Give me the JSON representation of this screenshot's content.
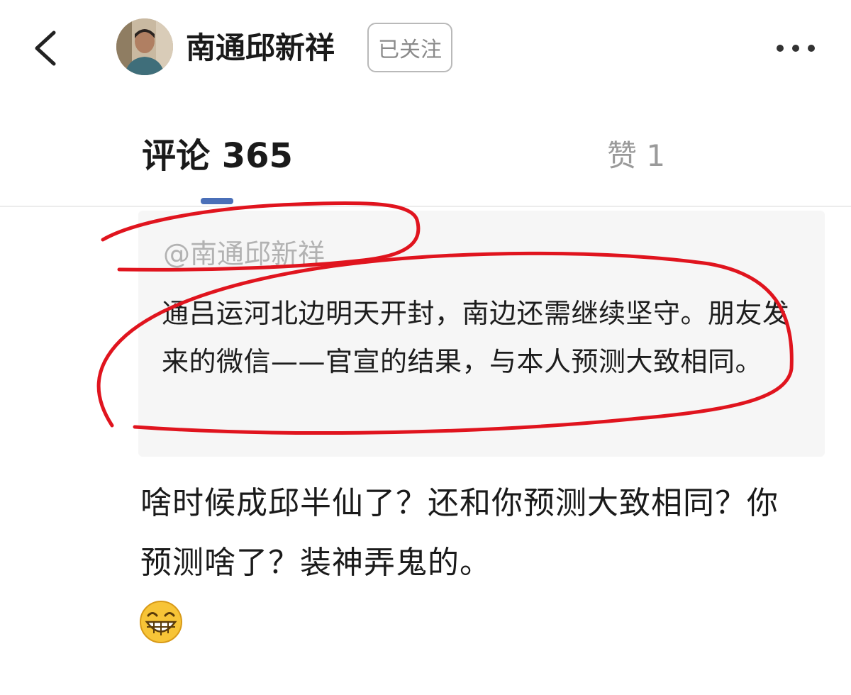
{
  "header": {
    "author_name": "南通邱新祥",
    "follow_label": "已关注",
    "back_icon": "chevron-left-icon",
    "more_icon": "more-dots-icon"
  },
  "tabs": {
    "comments_label": "评论 365",
    "likes_label": "赞 1",
    "active": "comments",
    "indicator_color": "#4a6fb8"
  },
  "quoted_comment": {
    "mention": "@南通邱新祥",
    "text": "通吕运河北边明天开封，南边还需继续坚守。朋友发来的微信——官宣的结果，与本人预测大致相同。"
  },
  "reply": {
    "text": "啥时候成邱半仙了？还和你预测大致相同？你预测啥了？装神弄鬼的。",
    "emoji": "grinning-face-icon"
  },
  "annotation_color": "#e0141e"
}
